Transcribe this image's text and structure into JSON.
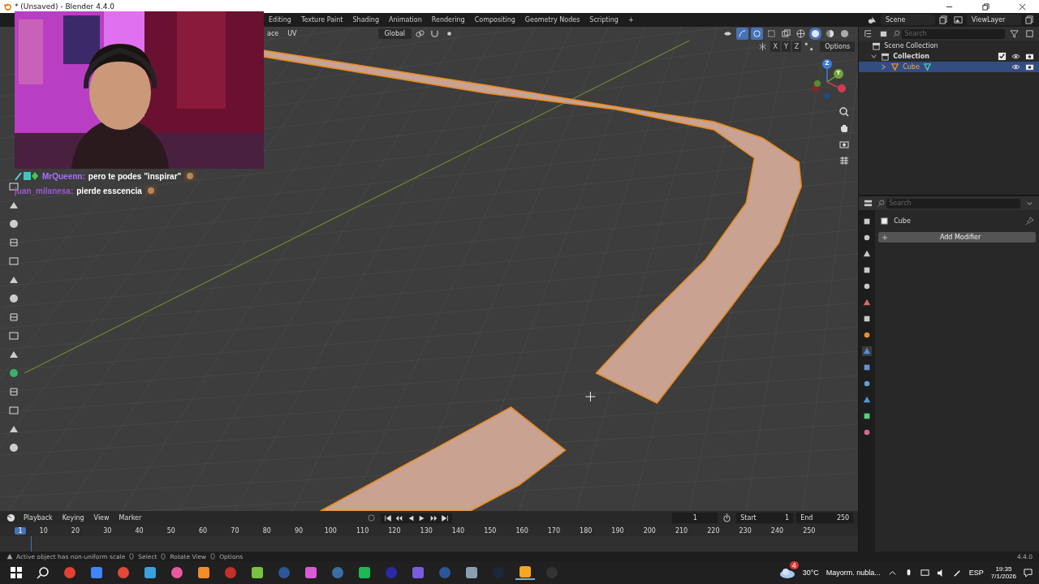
{
  "window": {
    "title": "* (Unsaved) - Blender 4.4.0"
  },
  "workspace_tabs": [
    {
      "label": "Editing",
      "selected": false
    },
    {
      "label": "Texture Paint",
      "selected": false
    },
    {
      "label": "Shading",
      "selected": false
    },
    {
      "label": "Animation",
      "selected": false
    },
    {
      "label": "Rendering",
      "selected": false
    },
    {
      "label": "Compositing",
      "selected": false
    },
    {
      "label": "Geometry Nodes",
      "selected": false
    },
    {
      "label": "Scripting",
      "selected": false
    }
  ],
  "add_tab": "+",
  "scene": {
    "name": "Scene"
  },
  "view_layer": {
    "name": "ViewLayer"
  },
  "viewport_header": {
    "menus": [
      "ace",
      "UV"
    ],
    "orientation": "Global",
    "axes": [
      "X",
      "Y",
      "Z"
    ],
    "options": "Options"
  },
  "chat": [
    {
      "user": "MrQueenn:",
      "message": "pero te podes \"inspirar\"",
      "color": "#a970ff"
    },
    {
      "user": "juan_milanesa:",
      "message": "pierde esscencia",
      "color": "#9b59d0"
    }
  ],
  "gizmo": {
    "axes": [
      "Z",
      "Y"
    ]
  },
  "outliner": {
    "search_placeholder": "Search",
    "items": [
      {
        "label": "Scene Collection",
        "selected": false,
        "children": [
          {
            "label": "Collection",
            "selected": false,
            "children": [
              {
                "label": "Cube",
                "selected": true
              }
            ]
          }
        ]
      }
    ]
  },
  "properties": {
    "search_placeholder": "Search",
    "object_name": "Cube",
    "add_modifier": "Add Modifier"
  },
  "timeline": {
    "menus": [
      "Playback",
      "Keying",
      "View",
      "Marker"
    ],
    "current_frame": "1",
    "start_label": "Start",
    "start": "1",
    "end_label": "End",
    "end": "250",
    "playhead": "1",
    "ticks": [
      "10",
      "20",
      "30",
      "40",
      "50",
      "60",
      "70",
      "80",
      "90",
      "100",
      "110",
      "120",
      "130",
      "140",
      "150",
      "160",
      "170",
      "180",
      "190",
      "200",
      "210",
      "220",
      "230",
      "240",
      "250"
    ]
  },
  "status_bar": {
    "warning": "Active object has non-uniform scale",
    "hints": [
      "Select",
      "Rotate View",
      "Options"
    ],
    "version": "4.4.0"
  },
  "taskbar": {
    "notification_count": "4",
    "temperature": "30°C",
    "forecast": "Mayorm. nubla...",
    "language": "ESP",
    "time": "19:35",
    "date": "7/1/2026"
  }
}
